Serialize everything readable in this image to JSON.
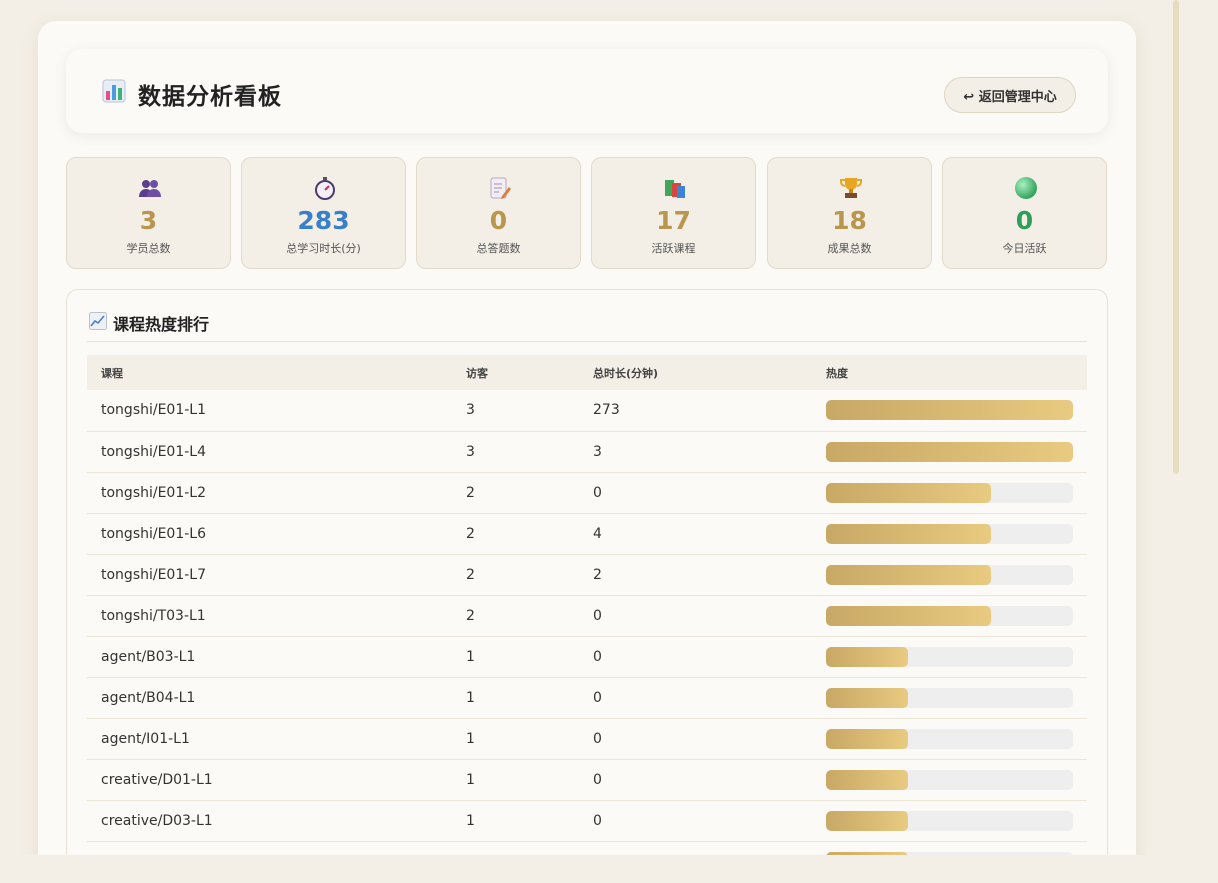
{
  "header": {
    "title": "数据分析看板",
    "back_button": "↩ 返回管理中心"
  },
  "stats": [
    {
      "icon": "people-icon",
      "value": "3",
      "label": "学员总数",
      "color": "#b8964e"
    },
    {
      "icon": "stopwatch-icon",
      "value": "283",
      "label": "总学习时长(分)",
      "color": "#3a7fc9"
    },
    {
      "icon": "memo-icon",
      "value": "0",
      "label": "总答题数",
      "color": "#b8964e"
    },
    {
      "icon": "books-icon",
      "value": "17",
      "label": "活跃课程",
      "color": "#b8964e"
    },
    {
      "icon": "trophy-icon",
      "value": "18",
      "label": "成果总数",
      "color": "#b8964e"
    },
    {
      "icon": "green-dot-icon",
      "value": "0",
      "label": "今日活跃",
      "color": "#2f9e5b"
    }
  ],
  "ranking": {
    "title": "课程热度排行",
    "columns": [
      "课程",
      "访客",
      "总时长(分钟)",
      "热度"
    ],
    "rows": [
      {
        "course": "tongshi/E01-L1",
        "visitors": "3",
        "duration": "273",
        "heat": 1.0
      },
      {
        "course": "tongshi/E01-L4",
        "visitors": "3",
        "duration": "3",
        "heat": 1.0
      },
      {
        "course": "tongshi/E01-L2",
        "visitors": "2",
        "duration": "0",
        "heat": 0.667
      },
      {
        "course": "tongshi/E01-L6",
        "visitors": "2",
        "duration": "4",
        "heat": 0.667
      },
      {
        "course": "tongshi/E01-L7",
        "visitors": "2",
        "duration": "2",
        "heat": 0.667
      },
      {
        "course": "tongshi/T03-L1",
        "visitors": "2",
        "duration": "0",
        "heat": 0.667
      },
      {
        "course": "agent/B03-L1",
        "visitors": "1",
        "duration": "0",
        "heat": 0.333
      },
      {
        "course": "agent/B04-L1",
        "visitors": "1",
        "duration": "0",
        "heat": 0.333
      },
      {
        "course": "agent/I01-L1",
        "visitors": "1",
        "duration": "0",
        "heat": 0.333
      },
      {
        "course": "creative/D01-L1",
        "visitors": "1",
        "duration": "0",
        "heat": 0.333
      },
      {
        "course": "creative/D03-L1",
        "visitors": "1",
        "duration": "0",
        "heat": 0.333
      },
      {
        "course": "",
        "visitors": "",
        "duration": "",
        "heat": 0.333
      }
    ]
  }
}
